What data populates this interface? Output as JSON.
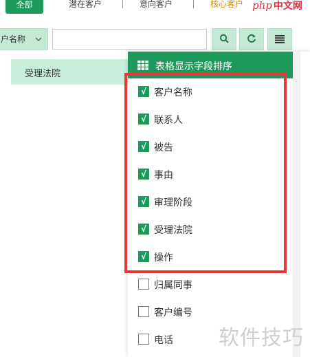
{
  "tabs": {
    "all": "全部",
    "potential": "潜在客户",
    "intent": "意向客户",
    "core": "核心客户"
  },
  "logo": {
    "php": "php",
    "cn": "中文网"
  },
  "search": {
    "field_select": "户名称",
    "input_value": "",
    "input_placeholder": ""
  },
  "table": {
    "visible_header": "受理法院"
  },
  "column_panel": {
    "title": "表格显示字段排序",
    "items": [
      {
        "label": "客户名称",
        "checked": true
      },
      {
        "label": "联系人",
        "checked": true
      },
      {
        "label": "被告",
        "checked": true
      },
      {
        "label": "事由",
        "checked": true
      },
      {
        "label": "审理阶段",
        "checked": true
      },
      {
        "label": "受理法院",
        "checked": true
      },
      {
        "label": "操作",
        "checked": true
      },
      {
        "label": "归属同事",
        "checked": false
      },
      {
        "label": "客户编号",
        "checked": false
      },
      {
        "label": "电话",
        "checked": false
      }
    ],
    "check_glyph": "√"
  },
  "watermark": "软件技巧",
  "colors": {
    "primary_green": "#1e9b5c",
    "light_green": "#c5e9d4",
    "highlight_red": "#e5393b",
    "core_tab": "#d58b00"
  },
  "icons": {
    "search": "search-icon",
    "refresh": "refresh-icon",
    "columns": "columns-icon",
    "grid": "grid-icon",
    "chevron": "chevron-down-icon"
  }
}
